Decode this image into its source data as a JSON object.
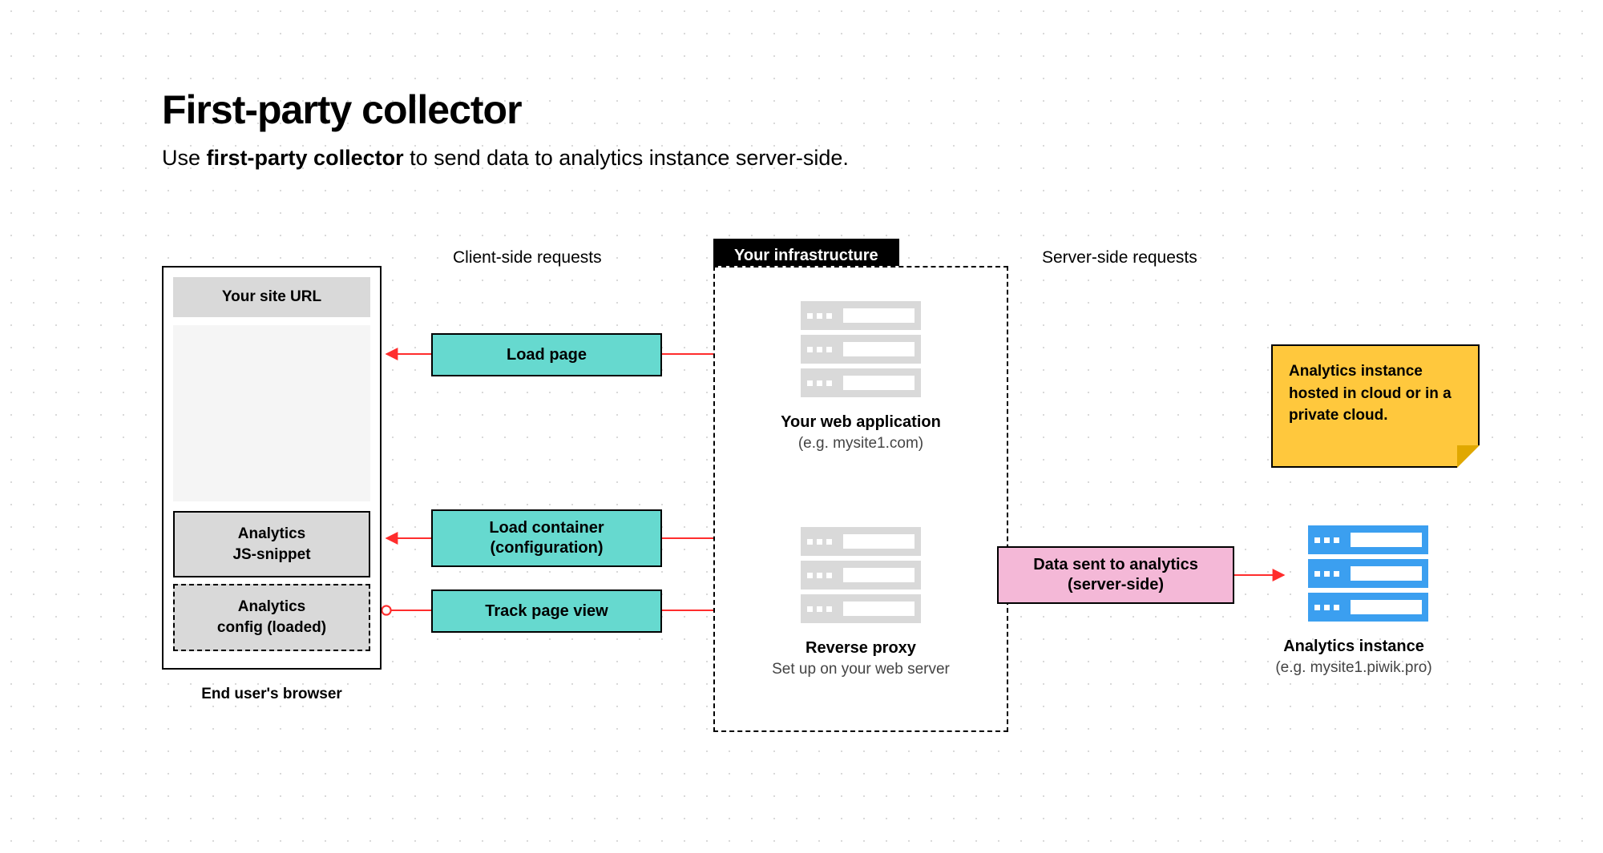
{
  "title": "First-party collector",
  "subtitle_prefix": "Use ",
  "subtitle_bold": "first-party collector",
  "subtitle_suffix": " to send data to analytics instance server-side.",
  "labels": {
    "client_side": "Client-side requests",
    "server_side": "Server-side requests",
    "infra_badge": "Your infrastructure"
  },
  "browser": {
    "url_label": "Your site URL",
    "snippet": "Analytics\nJS-snippet",
    "config": "Analytics\nconfig (loaded)",
    "caption": "End user's browser"
  },
  "requests": {
    "load_page": "Load page",
    "load_container": "Load container\n(configuration)",
    "track_page_view": "Track page view",
    "data_sent": "Data sent to analytics\n(server-side)"
  },
  "infra": {
    "webapp_title": "Your web application",
    "webapp_sub": "(e.g. mysite1.com)",
    "proxy_title": "Reverse proxy",
    "proxy_sub": "Set up on your web server"
  },
  "analytics": {
    "title": "Analytics instance",
    "sub": "(e.g. mysite1.piwik.pro)"
  },
  "sticky": "Analytics instance hosted in cloud or in a private cloud."
}
